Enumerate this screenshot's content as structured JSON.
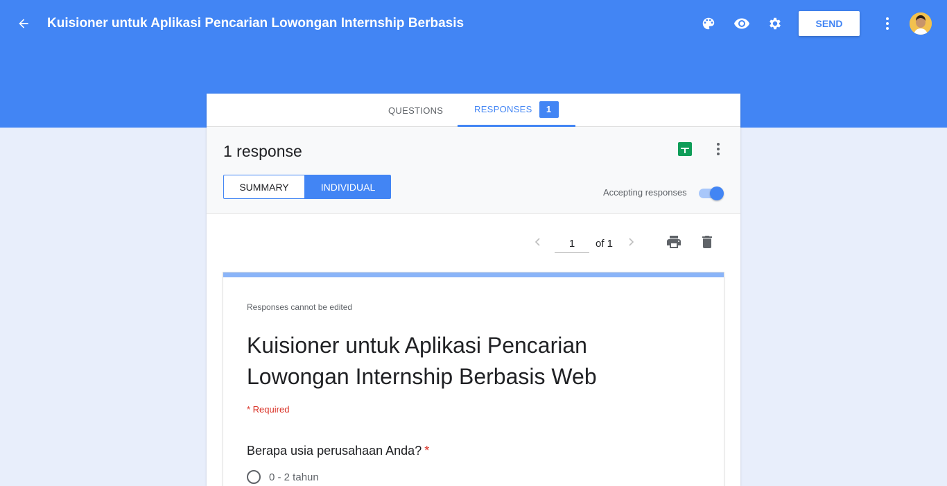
{
  "header": {
    "title": "Kuisioner untuk Aplikasi Pencarian Lowongan Internship Berbasis",
    "send_label": "SEND",
    "icons": [
      "arrow-back-icon",
      "palette-icon",
      "eye-icon",
      "gear-icon",
      "more-vert-icon",
      "avatar"
    ]
  },
  "tabs": {
    "questions_label": "QUESTIONS",
    "responses_label": "RESPONSES",
    "responses_count": "1"
  },
  "summary": {
    "count_text": "1 response",
    "summary_label": "SUMMARY",
    "individual_label": "INDIVIDUAL",
    "accepting_label": "Accepting responses",
    "accepting_on": true
  },
  "pager": {
    "current": "1",
    "of_text": "of 1"
  },
  "form": {
    "note": "Responses cannot be edited",
    "title": "Kuisioner untuk Aplikasi Pencarian Lowongan Internship Berbasis Web",
    "required_note": "* Required",
    "question": "Berapa usia perusahaan Anda?",
    "question_star": "*",
    "options": [
      "0 - 2 tahun"
    ]
  },
  "colors": {
    "accent": "#4285f4",
    "background": "#e8eefb",
    "sheets_green": "#0f9d58",
    "required_red": "#d93025"
  }
}
